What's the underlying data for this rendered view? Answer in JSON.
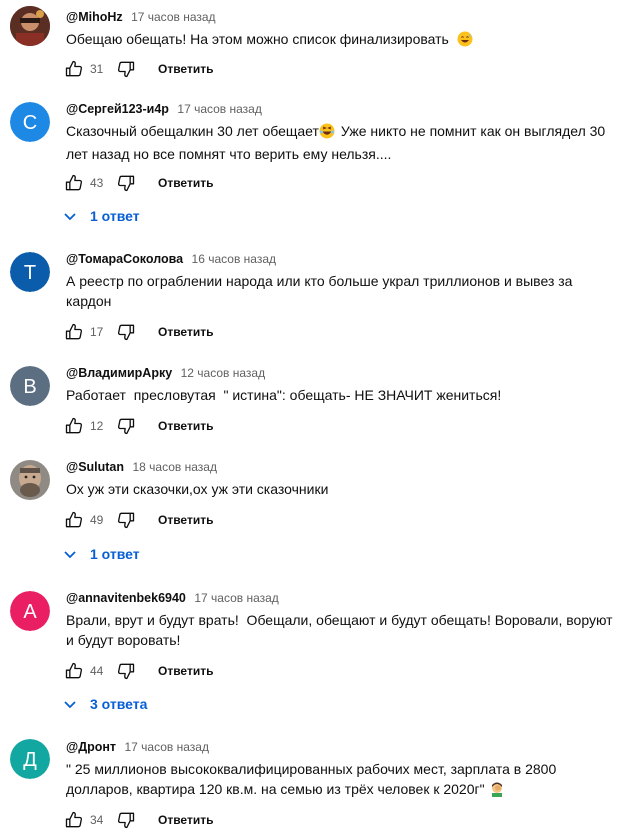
{
  "comments": [
    {
      "author": "@MihoHz",
      "time": "17 часов назад",
      "text": "Обещаю обещать! На этом можно список финализировать",
      "emoji": "grinning-sweat",
      "likes": "31",
      "reply_label": "Ответить",
      "avatar": "photo"
    },
    {
      "author": "@Сергей123-и4р",
      "time": "17 часов назад",
      "text": "Сказочный обещалкин 30 лет обещает",
      "text_after_emoji": "Уже никто не помнит как он выглядел 30 лет назад но все помнят что верить ему нельзя....",
      "emoji": "laughing",
      "likes": "43",
      "reply_label": "Ответить",
      "avatar_letter": "С",
      "avatar_color": "#1e88e5",
      "replies_label": "1 ответ"
    },
    {
      "author": "@ТомараСоколова",
      "time": "16 часов назад",
      "text": "А реестр по ограблении народа или кто больше украл триллионов и вывез за кардон",
      "likes": "17",
      "reply_label": "Ответить",
      "avatar_letter": "Т",
      "avatar_color": "#0b5cab"
    },
    {
      "author": "@ВладимирАрку",
      "time": "12 часов назад",
      "text": "Работает  пресловутая  \" истина\": обещать- НЕ ЗНАЧИТ жениться!",
      "likes": "12",
      "reply_label": "Ответить",
      "avatar_letter": "В",
      "avatar_color": "#5c6f82"
    },
    {
      "author": "@Sulutan",
      "time": "18 часов назад",
      "text": "Ох уж эти сказочки,ох уж эти сказочники",
      "likes": "49",
      "reply_label": "Ответить",
      "avatar": "photo",
      "replies_label": "1 ответ"
    },
    {
      "author": "@annavitenbek6940",
      "time": "17 часов назад",
      "text": "Врали, врут и будут врать!  Обещали, обещают и будут обещать! Воровали, воруют и будут воровать!",
      "likes": "44",
      "reply_label": "Ответить",
      "avatar_letter": "A",
      "avatar_color": "#e91e63",
      "replies_label": "3 ответа"
    },
    {
      "author": "@Дронт",
      "time": "17 часов назад",
      "text": "\" 25 миллионов высококвалифицированных рабочих мест, зарплата в 2800 долларов, квартира 120 кв.м. на семью из трёх человек к 2020г\"",
      "emoji": "facepalm",
      "likes": "34",
      "reply_label": "Ответить",
      "avatar_letter": "Д",
      "avatar_color": "#12a7a0"
    }
  ],
  "colors": {
    "text": "#0f0f0f",
    "meta": "#606060",
    "link": "#065fd4"
  },
  "icons": [
    "thumb-up-icon",
    "thumb-down-icon",
    "chevron-down-icon"
  ]
}
